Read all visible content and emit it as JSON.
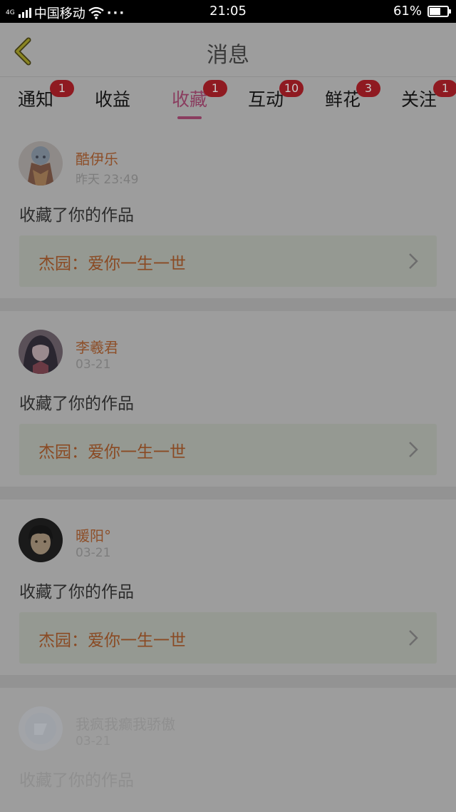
{
  "status_bar": {
    "network": "4G",
    "carrier": "中国移动",
    "more": "···",
    "time": "21:05",
    "battery": "61%",
    "battery_level": 0.61
  },
  "header": {
    "title": "消息"
  },
  "tabs": [
    {
      "label": "通知",
      "badge": "1",
      "active": false
    },
    {
      "label": "收益",
      "badge": "",
      "active": false
    },
    {
      "label": "收藏",
      "badge": "1",
      "active": true
    },
    {
      "label": "互动",
      "badge": "10",
      "active": false
    },
    {
      "label": "鲜花",
      "badge": "3",
      "active": false
    },
    {
      "label": "关注",
      "badge": "1",
      "active": false
    }
  ],
  "items": [
    {
      "user": "酷伊乐",
      "time": "昨天 23:49",
      "action": "收藏了你的作品",
      "work": "杰园：爱你一生一世"
    },
    {
      "user": "李羲君",
      "time": "03-21",
      "action": "收藏了你的作品",
      "work": "杰园：爱你一生一世"
    },
    {
      "user": "暖阳°",
      "time": "03-21",
      "action": "收藏了你的作品",
      "work": "杰园：爱你一生一世"
    },
    {
      "user": "我疯我癫我骄傲",
      "time": "03-21",
      "action": "收藏了你的作品",
      "work": ""
    }
  ],
  "colors": {
    "overlay_background": "#9d9d9d",
    "accent": "#8a3d5f",
    "badge": "#8f1a21",
    "username": "#8d4f29"
  }
}
